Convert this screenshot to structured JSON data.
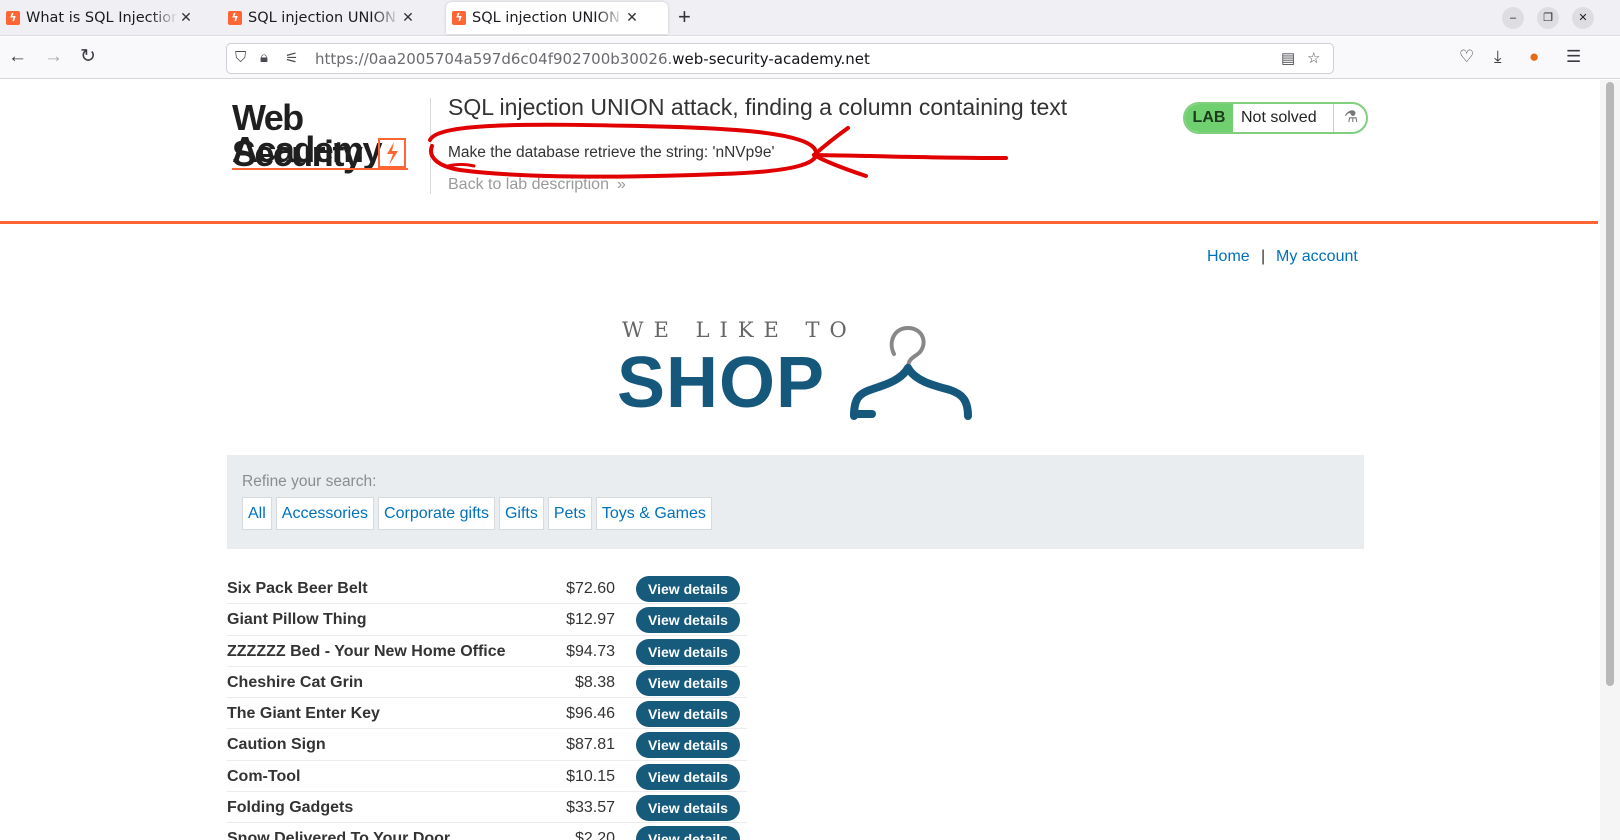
{
  "browser": {
    "tabs": [
      {
        "title": "What is SQL Injection? Tu"
      },
      {
        "title": "SQL injection UNION atta"
      },
      {
        "title": "SQL injection UNION atta"
      }
    ],
    "url_prefix": "https://0aa2005704a597d6c04f902700b30026.",
    "url_host": "web-security-academy.net"
  },
  "lab": {
    "logo_line1": "Web Security",
    "logo_line2": "Academy",
    "title": "SQL injection UNION attack, finding a column containing text",
    "task": "Make the database retrieve the string: 'nNVp9e'",
    "back_link": "Back to lab description",
    "badge_label": "LAB",
    "status": "Not solved"
  },
  "nav": {
    "home": "Home",
    "separator": "|",
    "account": "My account"
  },
  "hero": {
    "top": "WE LIKE TO",
    "main": "SHOP"
  },
  "filter": {
    "label": "Refine your search:",
    "categories": [
      "All",
      "Accessories",
      "Corporate gifts",
      "Gifts",
      "Pets",
      "Toys & Games"
    ]
  },
  "products": [
    {
      "name": "Six Pack Beer Belt",
      "price": "$72.60",
      "button": "View details"
    },
    {
      "name": "Giant Pillow Thing",
      "price": "$12.97",
      "button": "View details"
    },
    {
      "name": "ZZZZZZ Bed - Your New Home Office",
      "price": "$94.73",
      "button": "View details"
    },
    {
      "name": "Cheshire Cat Grin",
      "price": "$8.38",
      "button": "View details"
    },
    {
      "name": "The Giant Enter Key",
      "price": "$96.46",
      "button": "View details"
    },
    {
      "name": "Caution Sign",
      "price": "$87.81",
      "button": "View details"
    },
    {
      "name": "Com-Tool",
      "price": "$10.15",
      "button": "View details"
    },
    {
      "name": "Folding Gadgets",
      "price": "$33.57",
      "button": "View details"
    },
    {
      "name": "Snow Delivered To Your Door",
      "price": "$2.20",
      "button": "View details"
    }
  ],
  "colors": {
    "accent": "#ff6633",
    "link": "#0071bc",
    "button": "#165a7c",
    "lab_green": "#70d070",
    "annotation": "#e00000"
  }
}
